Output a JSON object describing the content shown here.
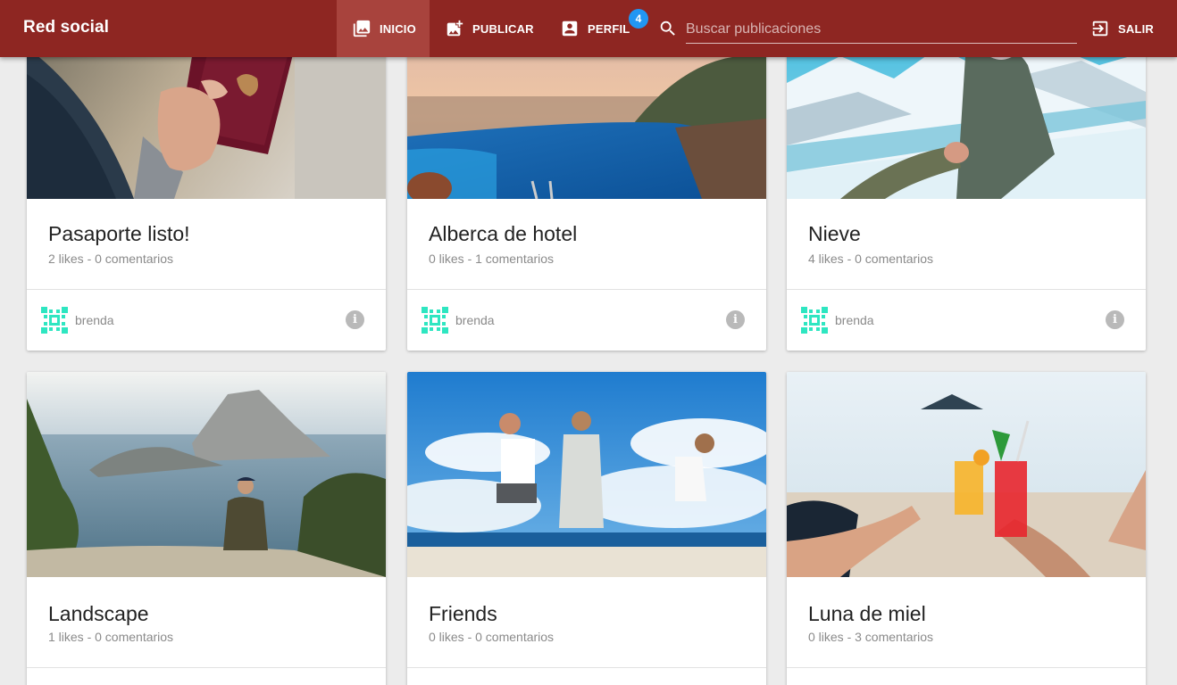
{
  "app": {
    "title": "Red social"
  },
  "nav": {
    "inicio": "INICIO",
    "publicar": "PUBLICAR",
    "perfil": "PERFIL",
    "perfil_badge": "4",
    "salir": "SALIR"
  },
  "search": {
    "placeholder": "Buscar publicaciones",
    "value": ""
  },
  "colors": {
    "appbar": "#8e2622",
    "appbar_active": "#a8433d",
    "badge": "#2196f3",
    "background": "#ececec"
  },
  "posts": [
    {
      "title": "Pasaporte listo!",
      "meta": "2 likes - 0 comentarios",
      "author": "brenda",
      "image": "passport-photo"
    },
    {
      "title": "Alberca de hotel",
      "meta": "0 likes - 1 comentarios",
      "author": "brenda",
      "image": "hotel-pool-photo"
    },
    {
      "title": "Nieve",
      "meta": "4 likes - 0 comentarios",
      "author": "brenda",
      "image": "snow-photo"
    },
    {
      "title": "Landscape",
      "meta": "1 likes - 0 comentarios",
      "author": "",
      "image": "landscape-photo"
    },
    {
      "title": "Friends",
      "meta": "0 likes - 0 comentarios",
      "author": "",
      "image": "friends-beach-photo"
    },
    {
      "title": "Luna de miel",
      "meta": "0 likes - 3 comentarios",
      "author": "",
      "image": "honeymoon-drinks-photo"
    }
  ]
}
